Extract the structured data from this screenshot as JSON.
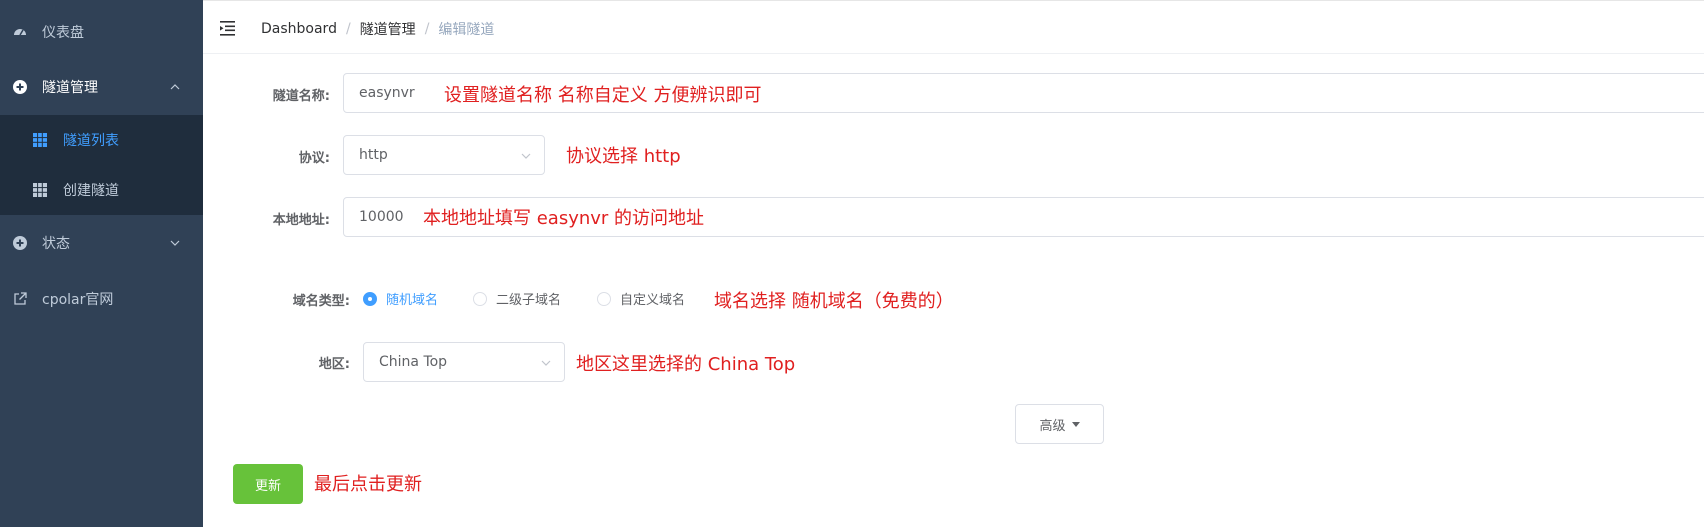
{
  "sidebar": {
    "items": [
      {
        "label": "仪表盘",
        "icon": "dashboard-icon"
      },
      {
        "label": "隧道管理",
        "icon": "plus-circle-icon"
      },
      {
        "label": "状态",
        "icon": "plus-circle-icon"
      },
      {
        "label": "cpolar官网",
        "icon": "external-link-icon"
      }
    ],
    "submenu": [
      {
        "label": "隧道列表",
        "icon": "table-icon"
      },
      {
        "label": "创建隧道",
        "icon": "table-icon"
      }
    ],
    "colors": {
      "bg": "#304156",
      "submenu_bg": "#1f2d3d",
      "active": "#409eff"
    }
  },
  "breadcrumb": {
    "items": [
      "Dashboard",
      "隧道管理",
      "编辑隧道"
    ],
    "separator": "/"
  },
  "form": {
    "name": {
      "label": "隧道名称:",
      "value": "easynvr"
    },
    "protocol": {
      "label": "协议:",
      "value": "http"
    },
    "local_addr": {
      "label": "本地地址:",
      "value": "10000"
    },
    "domain_type": {
      "label": "域名类型:",
      "options": [
        "随机域名",
        "二级子域名",
        "自定义域名"
      ],
      "selected": "随机域名"
    },
    "region": {
      "label": "地区:",
      "value": "China Top"
    },
    "advanced_label": "高级",
    "submit_label": "更新"
  },
  "annotations": {
    "name": "设置隧道名称 名称自定义 方便辨识即可",
    "protocol": "协议选择 http",
    "local_addr": "本地地址填写 easynvr 的访问地址",
    "domain_type": "域名选择 随机域名（免费的）",
    "region": "地区这里选择的 China Top",
    "submit": "最后点击更新"
  }
}
